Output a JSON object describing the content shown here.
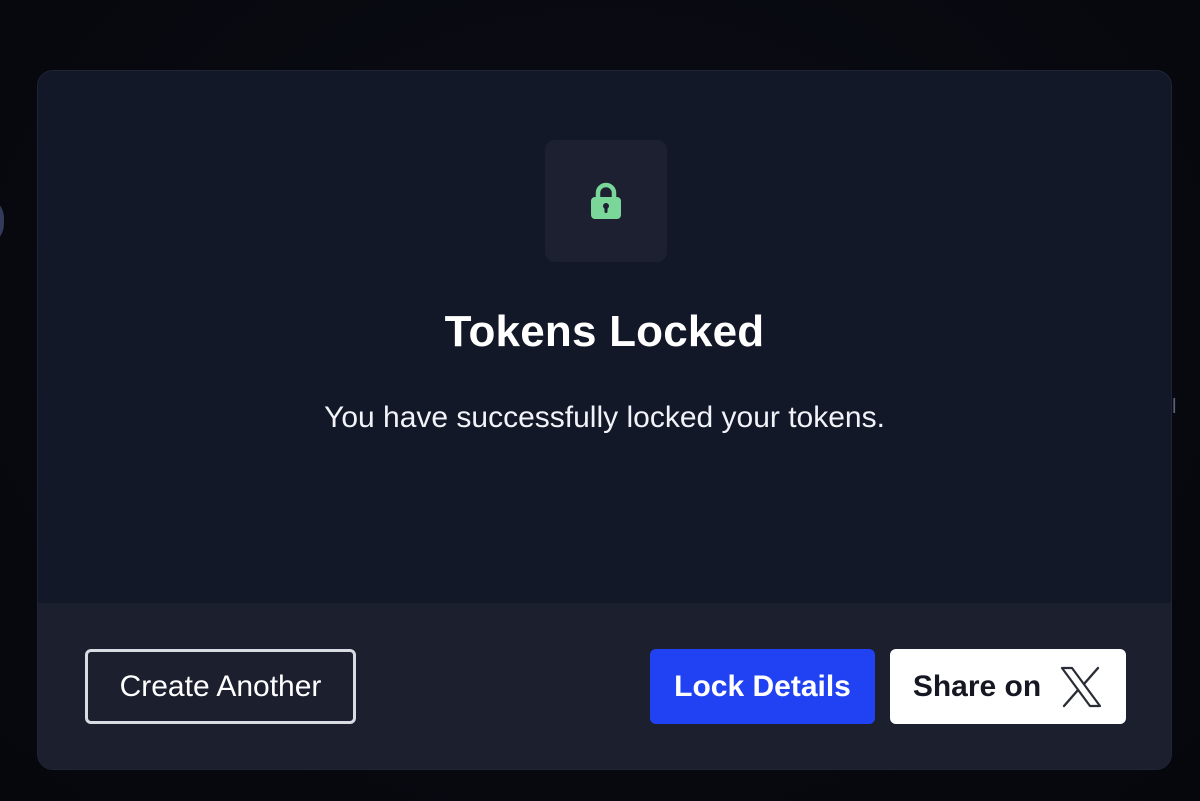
{
  "modal": {
    "icon": "lock-icon",
    "title": "Tokens Locked",
    "message": "You have successfully locked your tokens."
  },
  "actions": {
    "create_another": "Create Another",
    "lock_details": "Lock Details",
    "share_on": "Share on",
    "share_icon": "x-logo-icon"
  },
  "colors": {
    "accent": "#2142f2",
    "lock_icon": "#7bd69a",
    "modal_bg": "#141a2b",
    "footer_bg": "#1b1f2e"
  }
}
